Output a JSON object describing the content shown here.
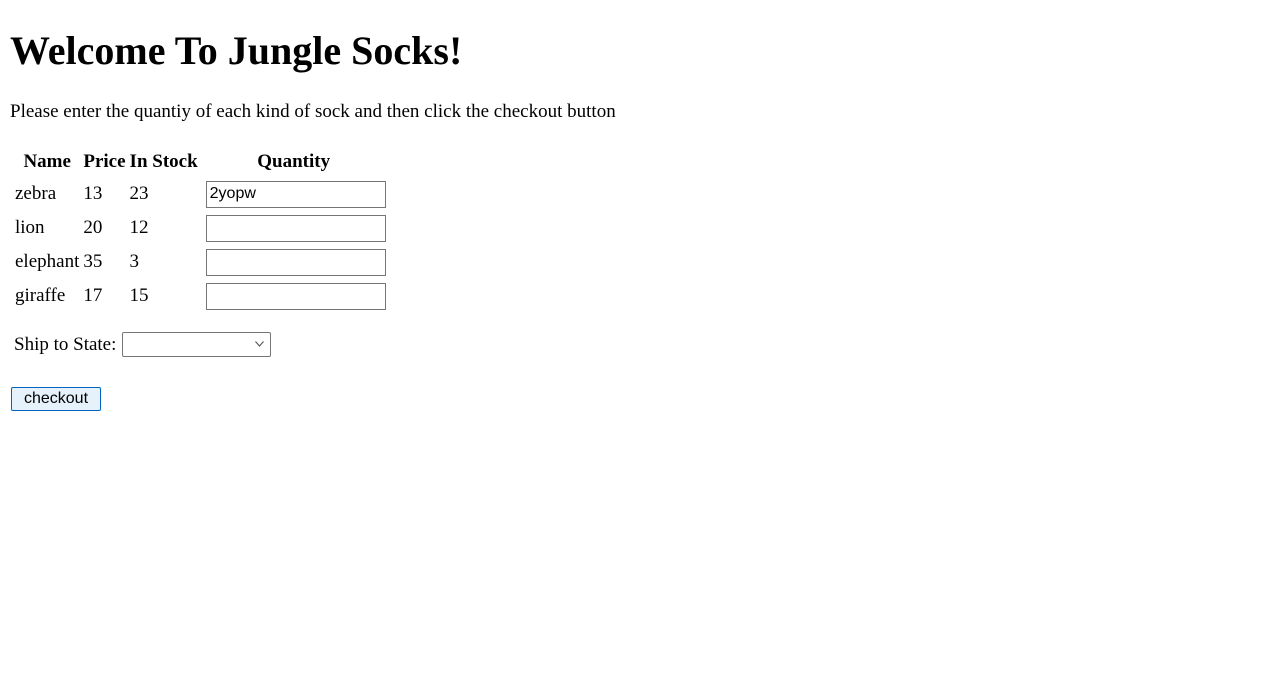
{
  "page": {
    "heading": "Welcome To Jungle Socks!",
    "instructions": "Please enter the quantiy of each kind of sock and then click the checkout button"
  },
  "table": {
    "headers": {
      "name": "Name",
      "price": "Price",
      "in_stock": "In Stock",
      "quantity": "Quantity"
    },
    "rows": [
      {
        "name": "zebra",
        "price": "13",
        "in_stock": "23",
        "quantity": "2yopw"
      },
      {
        "name": "lion",
        "price": "20",
        "in_stock": "12",
        "quantity": ""
      },
      {
        "name": "elephant",
        "price": "35",
        "in_stock": "3",
        "quantity": ""
      },
      {
        "name": "giraffe",
        "price": "17",
        "in_stock": "15",
        "quantity": ""
      }
    ]
  },
  "shipping": {
    "label": "Ship to State:",
    "selected_value": ""
  },
  "checkout": {
    "label": "checkout"
  },
  "icons": {
    "select_arrow": "chevron-down-icon"
  },
  "colors": {
    "button_border": "#0067c0",
    "button_background": "#e5f1fb",
    "input_border": "#767676"
  }
}
